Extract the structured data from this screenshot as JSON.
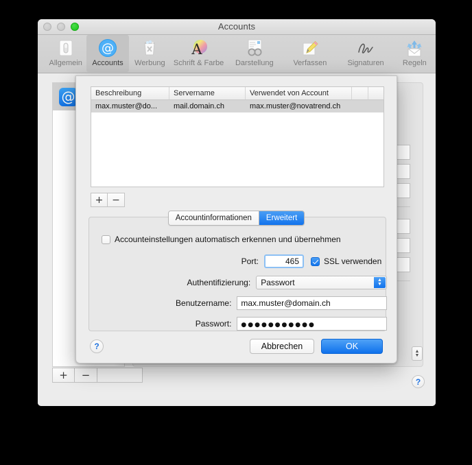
{
  "window": {
    "title": "Accounts",
    "traffic_lights": [
      {
        "name": "close",
        "color": "#c6c6c6",
        "active": false
      },
      {
        "name": "minimize",
        "color": "#c6c6c6",
        "active": false
      },
      {
        "name": "zoom",
        "color": "#17c617",
        "active": true
      }
    ]
  },
  "toolbar": {
    "items": [
      {
        "label": "Allgemein",
        "icon": "general-switch-icon",
        "selected": false
      },
      {
        "label": "Accounts",
        "icon": "at-sign-icon",
        "selected": true
      },
      {
        "label": "Werbung",
        "icon": "junk-trash-icon",
        "selected": false
      },
      {
        "label": "Schrift & Farbe",
        "icon": "font-color-icon",
        "selected": false
      },
      {
        "label": "Darstellung",
        "icon": "viewing-glasses-icon",
        "selected": false
      },
      {
        "label": "Verfassen",
        "icon": "compose-pencil-icon",
        "selected": false
      },
      {
        "label": "Signaturen",
        "icon": "signature-icon",
        "selected": false
      },
      {
        "label": "Regeln",
        "icon": "rules-envelope-icon",
        "selected": false
      }
    ]
  },
  "background": {
    "account_list": {
      "items": [
        {
          "icon": "at-sign-icon"
        }
      ],
      "add_label": "+",
      "remove_label": "−"
    },
    "help_label": "?"
  },
  "sheet": {
    "server_table": {
      "columns": [
        "Beschreibung",
        "Servername",
        "Verwendet von Account",
        "",
        ""
      ],
      "rows": [
        {
          "beschreibung": "max.muster@do...",
          "servername": "mail.domain.ch",
          "verwendet_von_account": "max.muster@novatrend.ch",
          "selected": true
        }
      ]
    },
    "table_controls": {
      "add_label": "+",
      "remove_label": "−"
    },
    "tabs": [
      {
        "label": "Accountinformationen",
        "active": false
      },
      {
        "label": "Erweitert",
        "active": true
      }
    ],
    "form": {
      "auto_detect": {
        "label": "Accounteinstellungen automatisch erkennen und übernehmen",
        "checked": false
      },
      "port": {
        "label": "Port:",
        "value": "465"
      },
      "ssl": {
        "label": "SSL verwenden",
        "checked": true
      },
      "authentication": {
        "label": "Authentifizierung:",
        "value": "Passwort"
      },
      "username": {
        "label": "Benutzername:",
        "value": "max.muster@domain.ch"
      },
      "password": {
        "label": "Passwort:",
        "value": "●●●●●●●●●●●"
      }
    },
    "footer": {
      "help_label": "?",
      "cancel_label": "Abbrechen",
      "ok_label": "OK"
    }
  },
  "colors": {
    "accent_blue": "#1273ec",
    "window_bg": "#ececec",
    "selection_gray": "#d6d6d6"
  }
}
